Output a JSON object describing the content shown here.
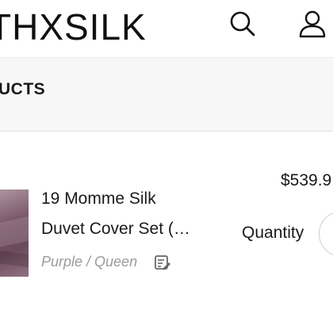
{
  "header": {
    "logo_text": "THXSILK",
    "search_icon": "search-icon",
    "account_icon": "user-icon"
  },
  "section": {
    "title": "UCTS"
  },
  "cart_item": {
    "name_line1": "19 Momme Silk",
    "name_line2": "Duvet Cover Set (…",
    "variant": "Purple / Queen",
    "edit_icon": "edit-note-icon",
    "price": "$539.9",
    "quantity_label": "Quantity",
    "thumbnail_color": "#7d5a6d"
  }
}
